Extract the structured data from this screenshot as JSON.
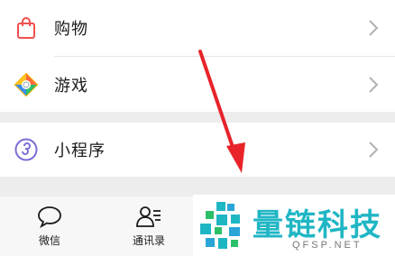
{
  "menu": {
    "shopping": {
      "label": "购物",
      "icon": "shopping-bag-icon"
    },
    "games": {
      "label": "游戏",
      "icon": "game-diamond-icon"
    },
    "mini_programs": {
      "label": "小程序",
      "icon": "mini-program-icon"
    }
  },
  "tabbar": {
    "chats": {
      "label": "微信",
      "icon": "chat-bubble-icon"
    },
    "contacts": {
      "label": "通讯录",
      "icon": "contacts-icon"
    }
  },
  "watermark": {
    "title": "量链科技",
    "subtitle": "QFSP.NET"
  },
  "colors": {
    "shopping_icon": "#f0504f",
    "arrow": "#e8232a",
    "watermark_text": "#1fb6c4"
  }
}
